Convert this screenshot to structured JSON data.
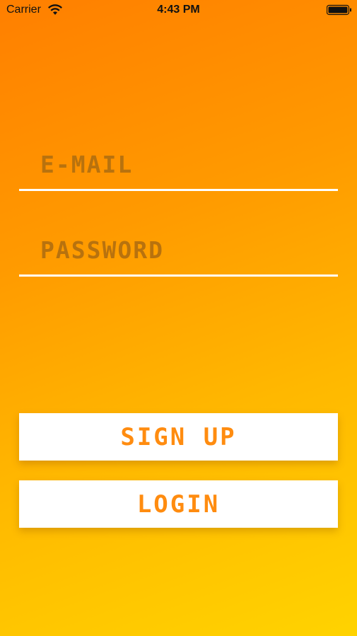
{
  "status_bar": {
    "carrier": "Carrier",
    "time": "4:43 PM"
  },
  "form": {
    "email_placeholder": "E-MAIL",
    "password_placeholder": "PASSWORD"
  },
  "actions": {
    "signup_label": "SIGN UP",
    "login_label": "LOGIN"
  },
  "colors": {
    "gradient_top": "#ff7f00",
    "gradient_bottom": "#ffd300",
    "button_text": "#ff8c10",
    "placeholder_text": "#b8720e",
    "button_background": "#ffffff"
  }
}
